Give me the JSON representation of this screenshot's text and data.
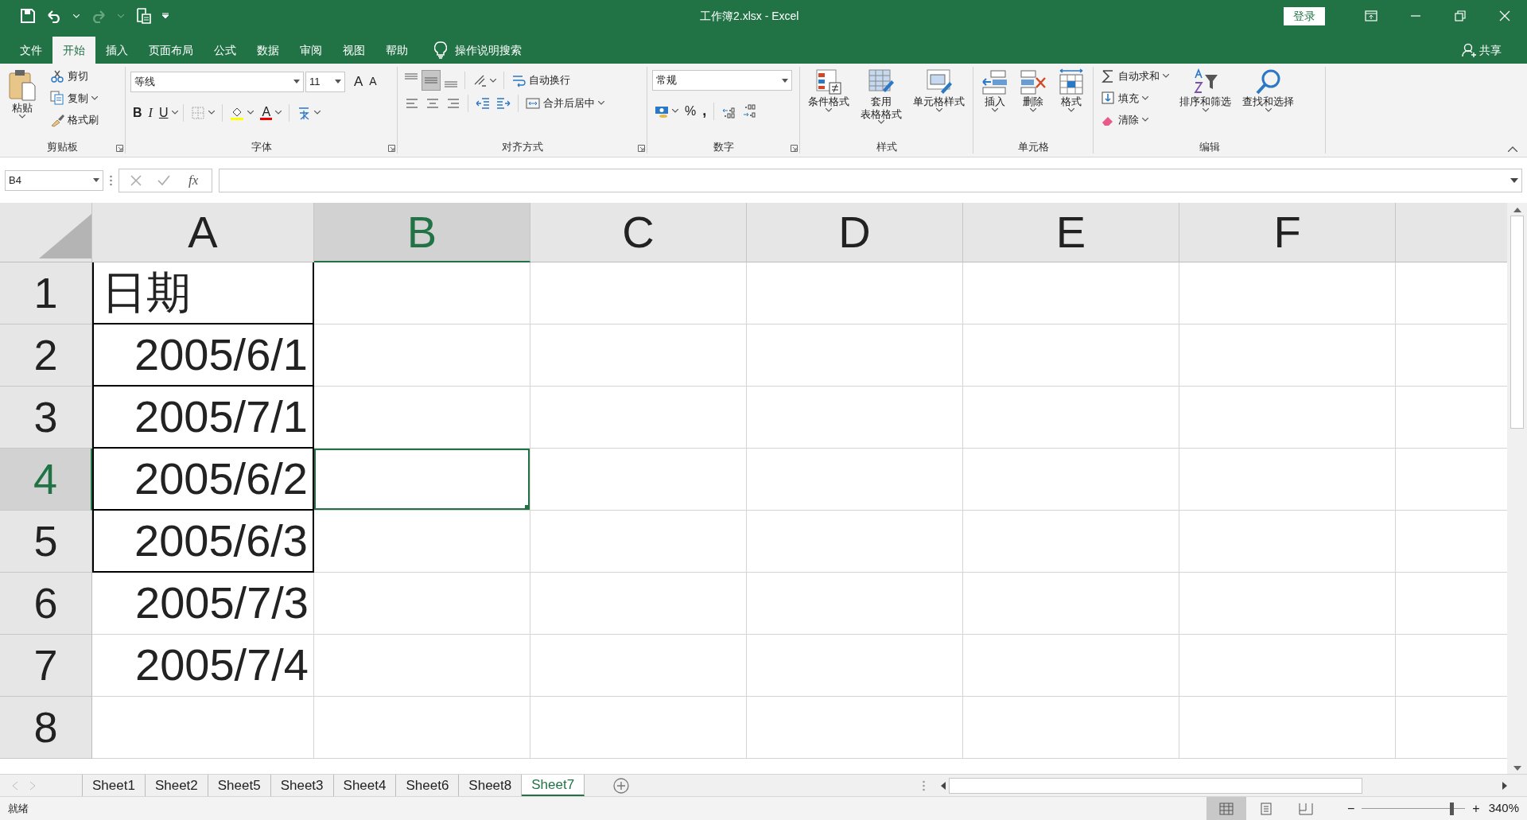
{
  "window": {
    "title": "工作簿2.xlsx  -  Excel",
    "login": "登录"
  },
  "quick_access": [
    {
      "kind": "save",
      "disabled": false
    },
    {
      "kind": "undo",
      "disabled": false
    },
    {
      "kind": "redo",
      "disabled": true
    },
    {
      "kind": "print_preview",
      "disabled": false
    },
    {
      "kind": "customize",
      "disabled": false
    }
  ],
  "ribbon_tabs": [
    {
      "label": "文件",
      "selected": false
    },
    {
      "label": "开始",
      "selected": true
    },
    {
      "label": "插入",
      "selected": false
    },
    {
      "label": "页面布局",
      "selected": false
    },
    {
      "label": "公式",
      "selected": false
    },
    {
      "label": "数据",
      "selected": false
    },
    {
      "label": "审阅",
      "selected": false
    },
    {
      "label": "视图",
      "selected": false
    },
    {
      "label": "帮助",
      "selected": false
    }
  ],
  "tell_me": "操作说明搜索",
  "share": "共享",
  "ribbon": {
    "groups": [
      {
        "kind": "clipboard",
        "label": "剪贴板",
        "launcher": true,
        "paste": "粘贴",
        "items": [
          {
            "kind": "cut",
            "label": "剪切"
          },
          {
            "kind": "copy",
            "label": "复制"
          },
          {
            "kind": "format_painter",
            "label": "格式刷"
          }
        ]
      },
      {
        "kind": "font",
        "label": "字体",
        "launcher": true,
        "font_name": "等线",
        "font_size": "11",
        "grow": "A",
        "shrink": "A",
        "bold": "B",
        "italic": "I",
        "underline": "U",
        "font_color": "A"
      },
      {
        "kind": "alignment",
        "label": "对齐方式",
        "launcher": true,
        "vertical": [
          {
            "kind": "top",
            "selected": false
          },
          {
            "kind": "middle",
            "selected": true
          },
          {
            "kind": "bottom",
            "selected": false
          }
        ],
        "horizontal": [
          {
            "kind": "left",
            "selected": false
          },
          {
            "kind": "center",
            "selected": false
          },
          {
            "kind": "right",
            "selected": false
          }
        ],
        "wrap": "自动换行",
        "merge": "合并后居中"
      },
      {
        "kind": "number",
        "label": "数字",
        "launcher": true,
        "format": "常规",
        "percent": "%",
        "comma": ","
      },
      {
        "kind": "large",
        "label": "样式",
        "launcher": false,
        "items": [
          {
            "kind": "conditional",
            "label": "条件格式"
          },
          {
            "kind": "table",
            "lines": [
              "套用",
              "表格格式"
            ]
          },
          {
            "kind": "cell_style",
            "label": "单元格样式"
          }
        ]
      },
      {
        "kind": "large",
        "label": "单元格",
        "launcher": false,
        "items": [
          {
            "kind": "insert",
            "label": "插入"
          },
          {
            "kind": "delete",
            "label": "删除"
          },
          {
            "kind": "format",
            "label": "格式"
          }
        ]
      },
      {
        "kind": "editing",
        "label": "编辑",
        "launcher": false,
        "items": [
          {
            "kind": "autosum",
            "label": "自动求和"
          },
          {
            "kind": "fill",
            "label": "填充"
          },
          {
            "kind": "clear",
            "label": "清除"
          }
        ],
        "large": [
          {
            "kind": "sort",
            "label": "排序和筛选"
          },
          {
            "kind": "find",
            "label": "查找和选择"
          }
        ]
      }
    ]
  },
  "formula_bar": {
    "name_box": "B4",
    "fx": "fx"
  },
  "columns": [
    {
      "label": "A",
      "selected": false
    },
    {
      "label": "B",
      "selected": true
    },
    {
      "label": "C",
      "selected": false
    },
    {
      "label": "D",
      "selected": false
    },
    {
      "label": "E",
      "selected": false
    },
    {
      "label": "F",
      "selected": false
    }
  ],
  "rows": [
    {
      "number": "1",
      "selected": false,
      "cells": [
        {
          "text": "日期",
          "kind": "text",
          "bordered": true,
          "active": false
        },
        {
          "active": false
        }
      ]
    },
    {
      "number": "2",
      "selected": false,
      "cells": [
        {
          "text": "2005/6/1",
          "kind": "date",
          "bordered": true,
          "active": false
        },
        {
          "active": false
        }
      ]
    },
    {
      "number": "3",
      "selected": false,
      "cells": [
        {
          "text": "2005/7/1",
          "kind": "date",
          "bordered": true,
          "active": false
        },
        {
          "active": false
        }
      ]
    },
    {
      "number": "4",
      "selected": true,
      "cells": [
        {
          "text": "2005/6/2",
          "kind": "date",
          "bordered": true,
          "active": false
        },
        {
          "active": true
        }
      ]
    },
    {
      "number": "5",
      "selected": false,
      "cells": [
        {
          "text": "2005/6/3",
          "kind": "date",
          "bordered": true,
          "active": false
        },
        {
          "active": false
        }
      ]
    },
    {
      "number": "6",
      "selected": false,
      "cells": [
        {
          "text": "2005/7/3",
          "kind": "date",
          "bordered": false,
          "active": false
        },
        {
          "active": false
        }
      ]
    },
    {
      "number": "7",
      "selected": false,
      "cells": [
        {
          "text": "2005/7/4",
          "kind": "date",
          "bordered": false,
          "active": false
        },
        {
          "active": false
        }
      ]
    },
    {
      "number": "8",
      "selected": false,
      "cells": [
        {
          "active": false
        },
        {
          "active": false
        }
      ]
    }
  ],
  "sheet_tabs": [
    {
      "label": "Sheet1",
      "selected": false
    },
    {
      "label": "Sheet2",
      "selected": false
    },
    {
      "label": "Sheet5",
      "selected": false
    },
    {
      "label": "Sheet3",
      "selected": false
    },
    {
      "label": "Sheet4",
      "selected": false
    },
    {
      "label": "Sheet6",
      "selected": false
    },
    {
      "label": "Sheet8",
      "selected": false
    },
    {
      "label": "Sheet7",
      "selected": true
    }
  ],
  "status_bar": {
    "status": "就绪",
    "views": [
      {
        "kind": "normal",
        "selected": true
      },
      {
        "kind": "page_layout",
        "selected": false
      },
      {
        "kind": "page_break",
        "selected": false
      }
    ],
    "zoom_out": "−",
    "zoom_in": "+",
    "zoom": {
      "level": 0.87,
      "reading": "340%"
    }
  }
}
